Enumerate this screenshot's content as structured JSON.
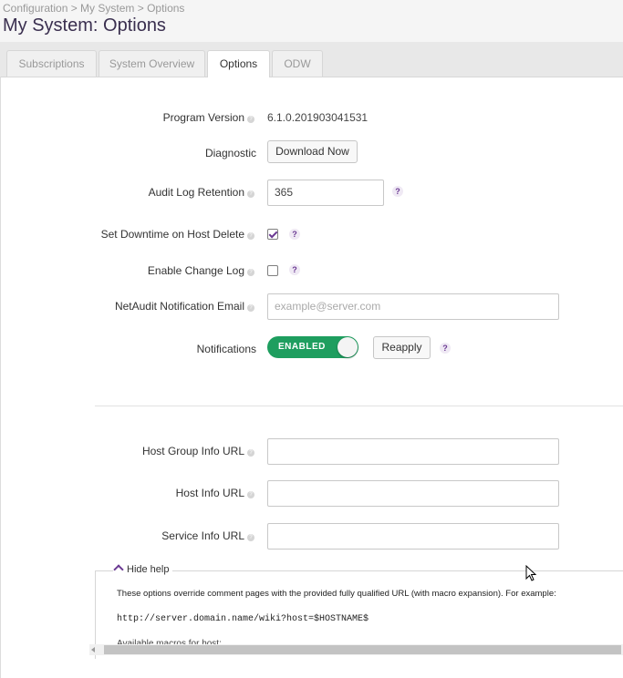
{
  "header": {
    "breadcrumb": "Configuration > My System > Options",
    "title": "My System: Options"
  },
  "tabs": [
    {
      "label": "Subscriptions",
      "active": false
    },
    {
      "label": "System Overview",
      "active": false
    },
    {
      "label": "Options",
      "active": true
    },
    {
      "label": "ODW",
      "active": false
    }
  ],
  "form": {
    "program_version": {
      "label": "Program Version",
      "value": "6.1.0.201903041531"
    },
    "diagnostic": {
      "label": "Diagnostic",
      "button": "Download Now"
    },
    "audit_log_retention": {
      "label": "Audit Log Retention",
      "value": "365"
    },
    "set_downtime": {
      "label": "Set Downtime on Host Delete",
      "checked": true
    },
    "enable_change_log": {
      "label": "Enable Change Log",
      "checked": false
    },
    "netaudit_email": {
      "label": "NetAudit Notification Email",
      "placeholder": "example@server.com",
      "value": ""
    },
    "notifications": {
      "label": "Notifications",
      "toggle_label": "ENABLED",
      "enabled": true,
      "reapply_button": "Reapply"
    },
    "host_group_info_url": {
      "label": "Host Group Info URL",
      "value": ""
    },
    "host_info_url": {
      "label": "Host Info URL",
      "value": ""
    },
    "service_info_url": {
      "label": "Service Info URL",
      "value": ""
    }
  },
  "help": {
    "toggle_label": "Hide help",
    "text": "These options override comment pages with the provided fully qualified URL (with macro expansion). For example:",
    "example": "http://server.domain.name/wiki?host=$HOSTNAME$",
    "more": "Available macros for host:"
  },
  "icons": {
    "hint": "info-dot-icon",
    "question": "question-icon",
    "chevron": "chevron-up-icon",
    "cursor": "mouse-pointer-icon"
  },
  "colors": {
    "accent": "#6b3a93",
    "toggle_on": "#1e9e5f",
    "title": "#3a2f4f"
  }
}
